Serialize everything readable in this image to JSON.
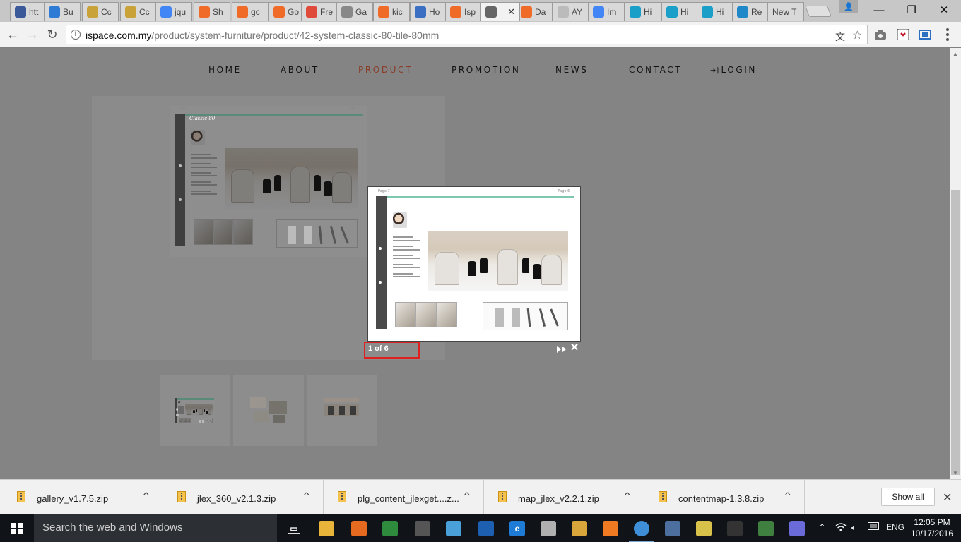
{
  "browser": {
    "tabs": [
      {
        "label": "htt",
        "icon": "facebook-icon",
        "color": "#3b5998"
      },
      {
        "label": "Bu",
        "icon": "bookmark-shield-icon",
        "color": "#2e7bd6"
      },
      {
        "label": "Cc",
        "icon": "joomla-icon",
        "color": "#c9a23a"
      },
      {
        "label": "Cc",
        "icon": "joomla-icon",
        "color": "#c9a23a"
      },
      {
        "label": "jqu",
        "icon": "google-icon",
        "color": "#4285f4"
      },
      {
        "label": "Sh",
        "icon": "joomla-icon",
        "color": "#f06a28"
      },
      {
        "label": "gc",
        "icon": "joomla-icon",
        "color": "#f06a28"
      },
      {
        "label": "Go",
        "icon": "joomla-icon",
        "color": "#f06a28"
      },
      {
        "label": "Fre",
        "icon": "pinwheel-icon",
        "color": "#e04a3a"
      },
      {
        "label": "Ga",
        "icon": "document-icon",
        "color": "#888888"
      },
      {
        "label": "kic",
        "icon": "joomla-icon",
        "color": "#f06a28"
      },
      {
        "label": "Ho",
        "icon": "site-logo-icon",
        "color": "#3a6fc4"
      },
      {
        "label": "Isp",
        "icon": "joomla-icon",
        "color": "#f06a28"
      },
      {
        "label": "",
        "icon": "loading-icon",
        "color": "#666666"
      },
      {
        "label": "Da",
        "icon": "joomla-icon",
        "color": "#f06a28"
      },
      {
        "label": "AY",
        "icon": "page-icon",
        "color": "#bbbbbb"
      },
      {
        "label": "Im",
        "icon": "google-icon",
        "color": "#4285f4"
      },
      {
        "label": "Hi",
        "icon": "snowflake-icon",
        "color": "#1aa0c8"
      },
      {
        "label": "Hi",
        "icon": "snowflake-icon",
        "color": "#1aa0c8"
      },
      {
        "label": "Hi",
        "icon": "snowflake-icon",
        "color": "#1aa0c8"
      },
      {
        "label": "Re",
        "icon": "spiral-icon",
        "color": "#1f88c9"
      },
      {
        "label": "New T",
        "icon": "",
        "color": ""
      }
    ],
    "close_glyph": "✕",
    "window_controls": {
      "minimize": "—",
      "maximize": "❐",
      "close": "✕"
    },
    "nav": {
      "back": "←",
      "forward": "→",
      "reload": "↻"
    },
    "url": {
      "host": "ispace.com.my",
      "path": "/product/system-furniture/product/42-system-classic-80-tile-80mm"
    },
    "omnibox_icons": {
      "translate": "文",
      "bookmark": "☆"
    }
  },
  "site": {
    "nav": [
      {
        "label": "HOME",
        "active": false
      },
      {
        "label": "ABOUT",
        "active": false
      },
      {
        "label": "PRODUCT",
        "active": true
      },
      {
        "label": "PROMOTION",
        "active": false
      },
      {
        "label": "NEWS",
        "active": false
      },
      {
        "label": "CONTACT",
        "active": false
      },
      {
        "label": "LOGIN",
        "active": false,
        "icon": "login-icon"
      }
    ],
    "catalog": {
      "page_left": "Page 7",
      "page_right": "Page 6",
      "series_logo": "Classic 80"
    },
    "thumbnail_count": 3,
    "lightbox": {
      "counter": "1 of 6",
      "close": "✕"
    }
  },
  "downloads": {
    "items": [
      {
        "name": "gallery_v1.7.5.zip"
      },
      {
        "name": "jlex_360_v2.1.3.zip"
      },
      {
        "name": "plg_content_jlexget....z..."
      },
      {
        "name": "map_jlex_v2.2.1.zip"
      },
      {
        "name": "contentmap-1.3.8.zip"
      }
    ],
    "caret": "^",
    "show_all": "Show all",
    "close": "✕"
  },
  "taskbar": {
    "search_placeholder": "Search the web and Windows",
    "apps": [
      {
        "name": "task-view-icon",
        "color": "#101418",
        "glyph": "▭"
      },
      {
        "name": "file-explorer-icon",
        "color": "#e8b53a",
        "glyph": ""
      },
      {
        "name": "firefox-icon",
        "color": "#e66a1f",
        "glyph": ""
      },
      {
        "name": "editor-icon",
        "color": "#2e8b3e",
        "glyph": ""
      },
      {
        "name": "tool-icon",
        "color": "#555555",
        "glyph": ""
      },
      {
        "name": "notepad-icon",
        "color": "#4aa0d8",
        "glyph": ""
      },
      {
        "name": "security-icon",
        "color": "#1d5fb0",
        "glyph": ""
      },
      {
        "name": "edge-icon",
        "color": "#1e7bd6",
        "glyph": "e"
      },
      {
        "name": "paint-icon",
        "color": "#b0b0b0",
        "glyph": ""
      },
      {
        "name": "palette-icon",
        "color": "#d8a63a",
        "glyph": ""
      },
      {
        "name": "xampp-icon",
        "color": "#f07a22",
        "glyph": ""
      },
      {
        "name": "chrome-icon",
        "color": "#3f8fd8",
        "glyph": ""
      },
      {
        "name": "browser-alt-icon",
        "color": "#4d6fa0",
        "glyph": ""
      },
      {
        "name": "folder-icon",
        "color": "#d9c24a",
        "glyph": ""
      },
      {
        "name": "photos-icon",
        "color": "#333333",
        "glyph": ""
      },
      {
        "name": "network-tool-icon",
        "color": "#3f7f3f",
        "glyph": ""
      },
      {
        "name": "remote-icon",
        "color": "#6a6ad8",
        "glyph": ""
      }
    ],
    "language": "ENG",
    "time": "12:05 PM",
    "date": "10/17/2016"
  }
}
